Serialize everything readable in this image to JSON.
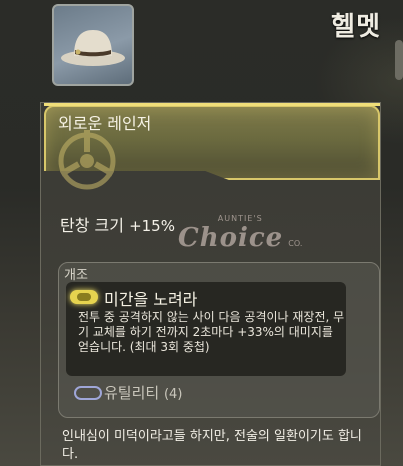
{
  "header": {
    "category": "헬멧",
    "thumbnail_icon": "cowboy-hat-icon"
  },
  "item": {
    "name": "외로운 레인저",
    "stat_label": "탄창 크기",
    "stat_value": "+15%"
  },
  "watermark": {
    "top": "AUNTIE'S",
    "main": "Choice",
    "suffix": "CO."
  },
  "mod": {
    "header": "개조",
    "perk_icon": "perk-pill-icon",
    "perk_title": "미간을 노려라",
    "perk_description": "전투 중 공격하지 않는 사이 다음 공격이나 재장전, 무기 교체를 하기 전까지 2초마다 +33%의 대미지를 얻습니다. (최대 3회 중첩)",
    "utility_icon": "utility-ring-icon",
    "utility_label": "유틸리티",
    "utility_count": "(4)"
  },
  "flavor_text": "인내심이 미덕이라고들 하지만, 전술의 일환이기도 합니다.",
  "colors": {
    "accent_gold": "#d8c76a",
    "perk_yellow": "#e6d34f",
    "utility_blue": "#9fa6d8"
  }
}
